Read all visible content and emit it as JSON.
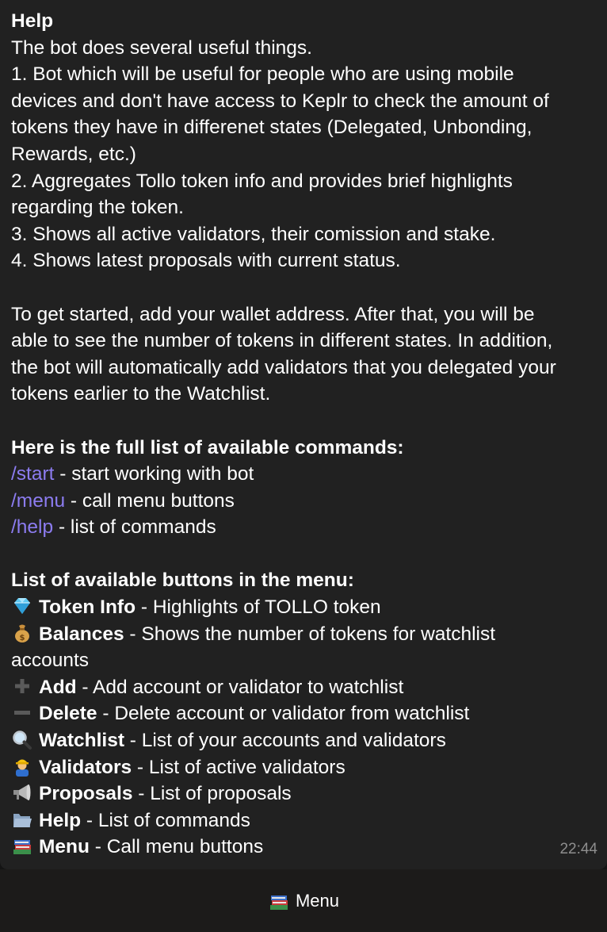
{
  "message": {
    "heading": "Help",
    "lines": [
      "The bot does several useful things.",
      "1. Bot which will be useful for people who are using mobile",
      "devices and don't have access to Keplr to check the amount of",
      "tokens they have in differenet states (Delegated, Unbonding,",
      "Rewards, etc.)",
      "2. Aggregates Tollo token info and provides brief highlights",
      "regarding the token.",
      "3. Shows all active validators, their comission and stake.",
      "4. Shows latest proposals with current status."
    ],
    "paragraph2": [
      "To get started, add your wallet address. After that, you will be",
      "able to see the number of tokens in different states. In addition,",
      "the bot will automatically add validators that you delegated your",
      "tokens earlier to the Watchlist."
    ],
    "commands_heading": "Here is the full list of available commands:",
    "commands": [
      {
        "cmd": "/start",
        "desc": " - start working with bot"
      },
      {
        "cmd": "/menu",
        "desc": " - call menu buttons"
      },
      {
        "cmd": "/help",
        "desc": " - list of commands"
      }
    ],
    "buttons_heading": "List of available buttons in the menu:",
    "buttons": [
      {
        "icon": "gem-icon",
        "name": "Token Info",
        "desc": " - Highlights of TOLLO token"
      },
      {
        "icon": "money-bag-icon",
        "name": "Balances",
        "desc": " - Shows the number of tokens for watchlist",
        "cont": "accounts"
      },
      {
        "icon": "plus-icon",
        "name": "Add",
        "desc": " - Add account or validator to watchlist"
      },
      {
        "icon": "minus-icon",
        "name": "Delete",
        "desc": " - Delete account or validator from watchlist"
      },
      {
        "icon": "magnifier-icon",
        "name": "Watchlist",
        "desc": " - List of your accounts and validators"
      },
      {
        "icon": "construction-worker-icon",
        "name": "Validators",
        "desc": " - List of active validators"
      },
      {
        "icon": "megaphone-icon",
        "name": "Proposals",
        "desc": " - List of proposals"
      },
      {
        "icon": "folder-icon",
        "name": "Help",
        "desc": " - List of commands"
      },
      {
        "icon": "books-icon",
        "name": "Menu",
        "desc": " - Call menu buttons"
      }
    ],
    "time": "22:44"
  },
  "keyboard": {
    "button_icon": "books-icon",
    "button_label": "Menu"
  },
  "colors": {
    "background": "#141414",
    "bubble": "#212121",
    "command_link": "#8c7cf0",
    "timestamp": "#8e8e8e"
  }
}
